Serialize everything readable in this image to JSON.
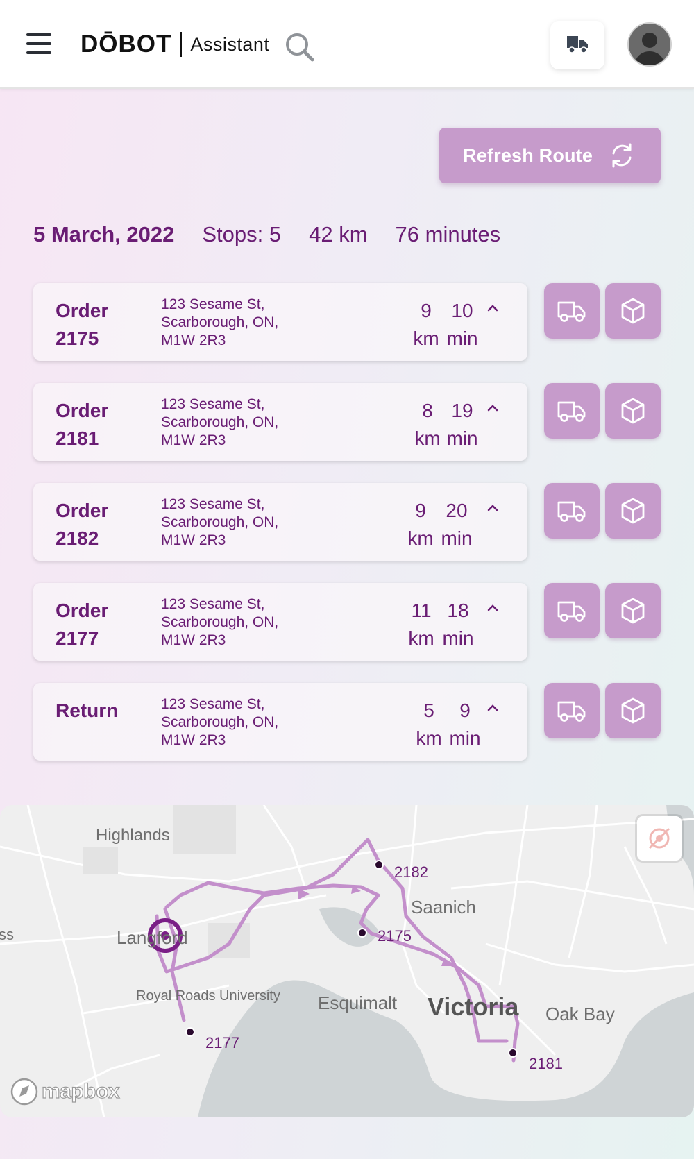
{
  "header": {
    "logo_mark": "DŌBOT",
    "logo_sub": "Assistant"
  },
  "actions": {
    "refresh_label": "Refresh Route"
  },
  "summary": {
    "date": "5 March, 2022",
    "stops": "Stops: 5",
    "distance": "42 km",
    "duration": "76 minutes"
  },
  "orders": [
    {
      "title_1": "Order",
      "title_2": "2175",
      "addr_1": "123 Sesame St,",
      "addr_2": "Scarborough, ON,",
      "addr_3": "M1W 2R3",
      "km": "9",
      "km_unit": "km",
      "min": "10",
      "min_unit": "min"
    },
    {
      "title_1": "Order",
      "title_2": "2181",
      "addr_1": "123 Sesame St,",
      "addr_2": "Scarborough, ON,",
      "addr_3": "M1W 2R3",
      "km": "8",
      "km_unit": "km",
      "min": "19",
      "min_unit": "min"
    },
    {
      "title_1": "Order",
      "title_2": "2182",
      "addr_1": "123 Sesame St,",
      "addr_2": "Scarborough, ON,",
      "addr_3": "M1W 2R3",
      "km": "9",
      "km_unit": "km",
      "min": "20",
      "min_unit": "min"
    },
    {
      "title_1": "Order",
      "title_2": "2177",
      "addr_1": "123 Sesame St,",
      "addr_2": "Scarborough, ON,",
      "addr_3": "M1W 2R3",
      "km": "11",
      "km_unit": "km",
      "min": "18",
      "min_unit": "min"
    },
    {
      "title_1": "Return",
      "title_2": "",
      "addr_1": "123 Sesame St,",
      "addr_2": "Scarborough, ON,",
      "addr_3": "M1W 2R3",
      "km": "5",
      "km_unit": "km",
      "min": "9",
      "min_unit": "min"
    }
  ],
  "map": {
    "places": {
      "highlands": "Highlands",
      "langford": "Langford",
      "saanich": "Saanich",
      "royal_roads": "Royal Roads University",
      "esquimalt": "Esquimalt",
      "victoria": "Victoria",
      "oak_bay": "Oak Bay",
      "edge": "ss"
    },
    "stops": {
      "s2182": "2182",
      "s2175": "2175",
      "s2177": "2177",
      "s2181": "2181"
    },
    "attribution": "mapbox"
  },
  "colors": {
    "primary": "#6a1d74",
    "button": "#c69bcb",
    "route": "#c38fcb"
  }
}
